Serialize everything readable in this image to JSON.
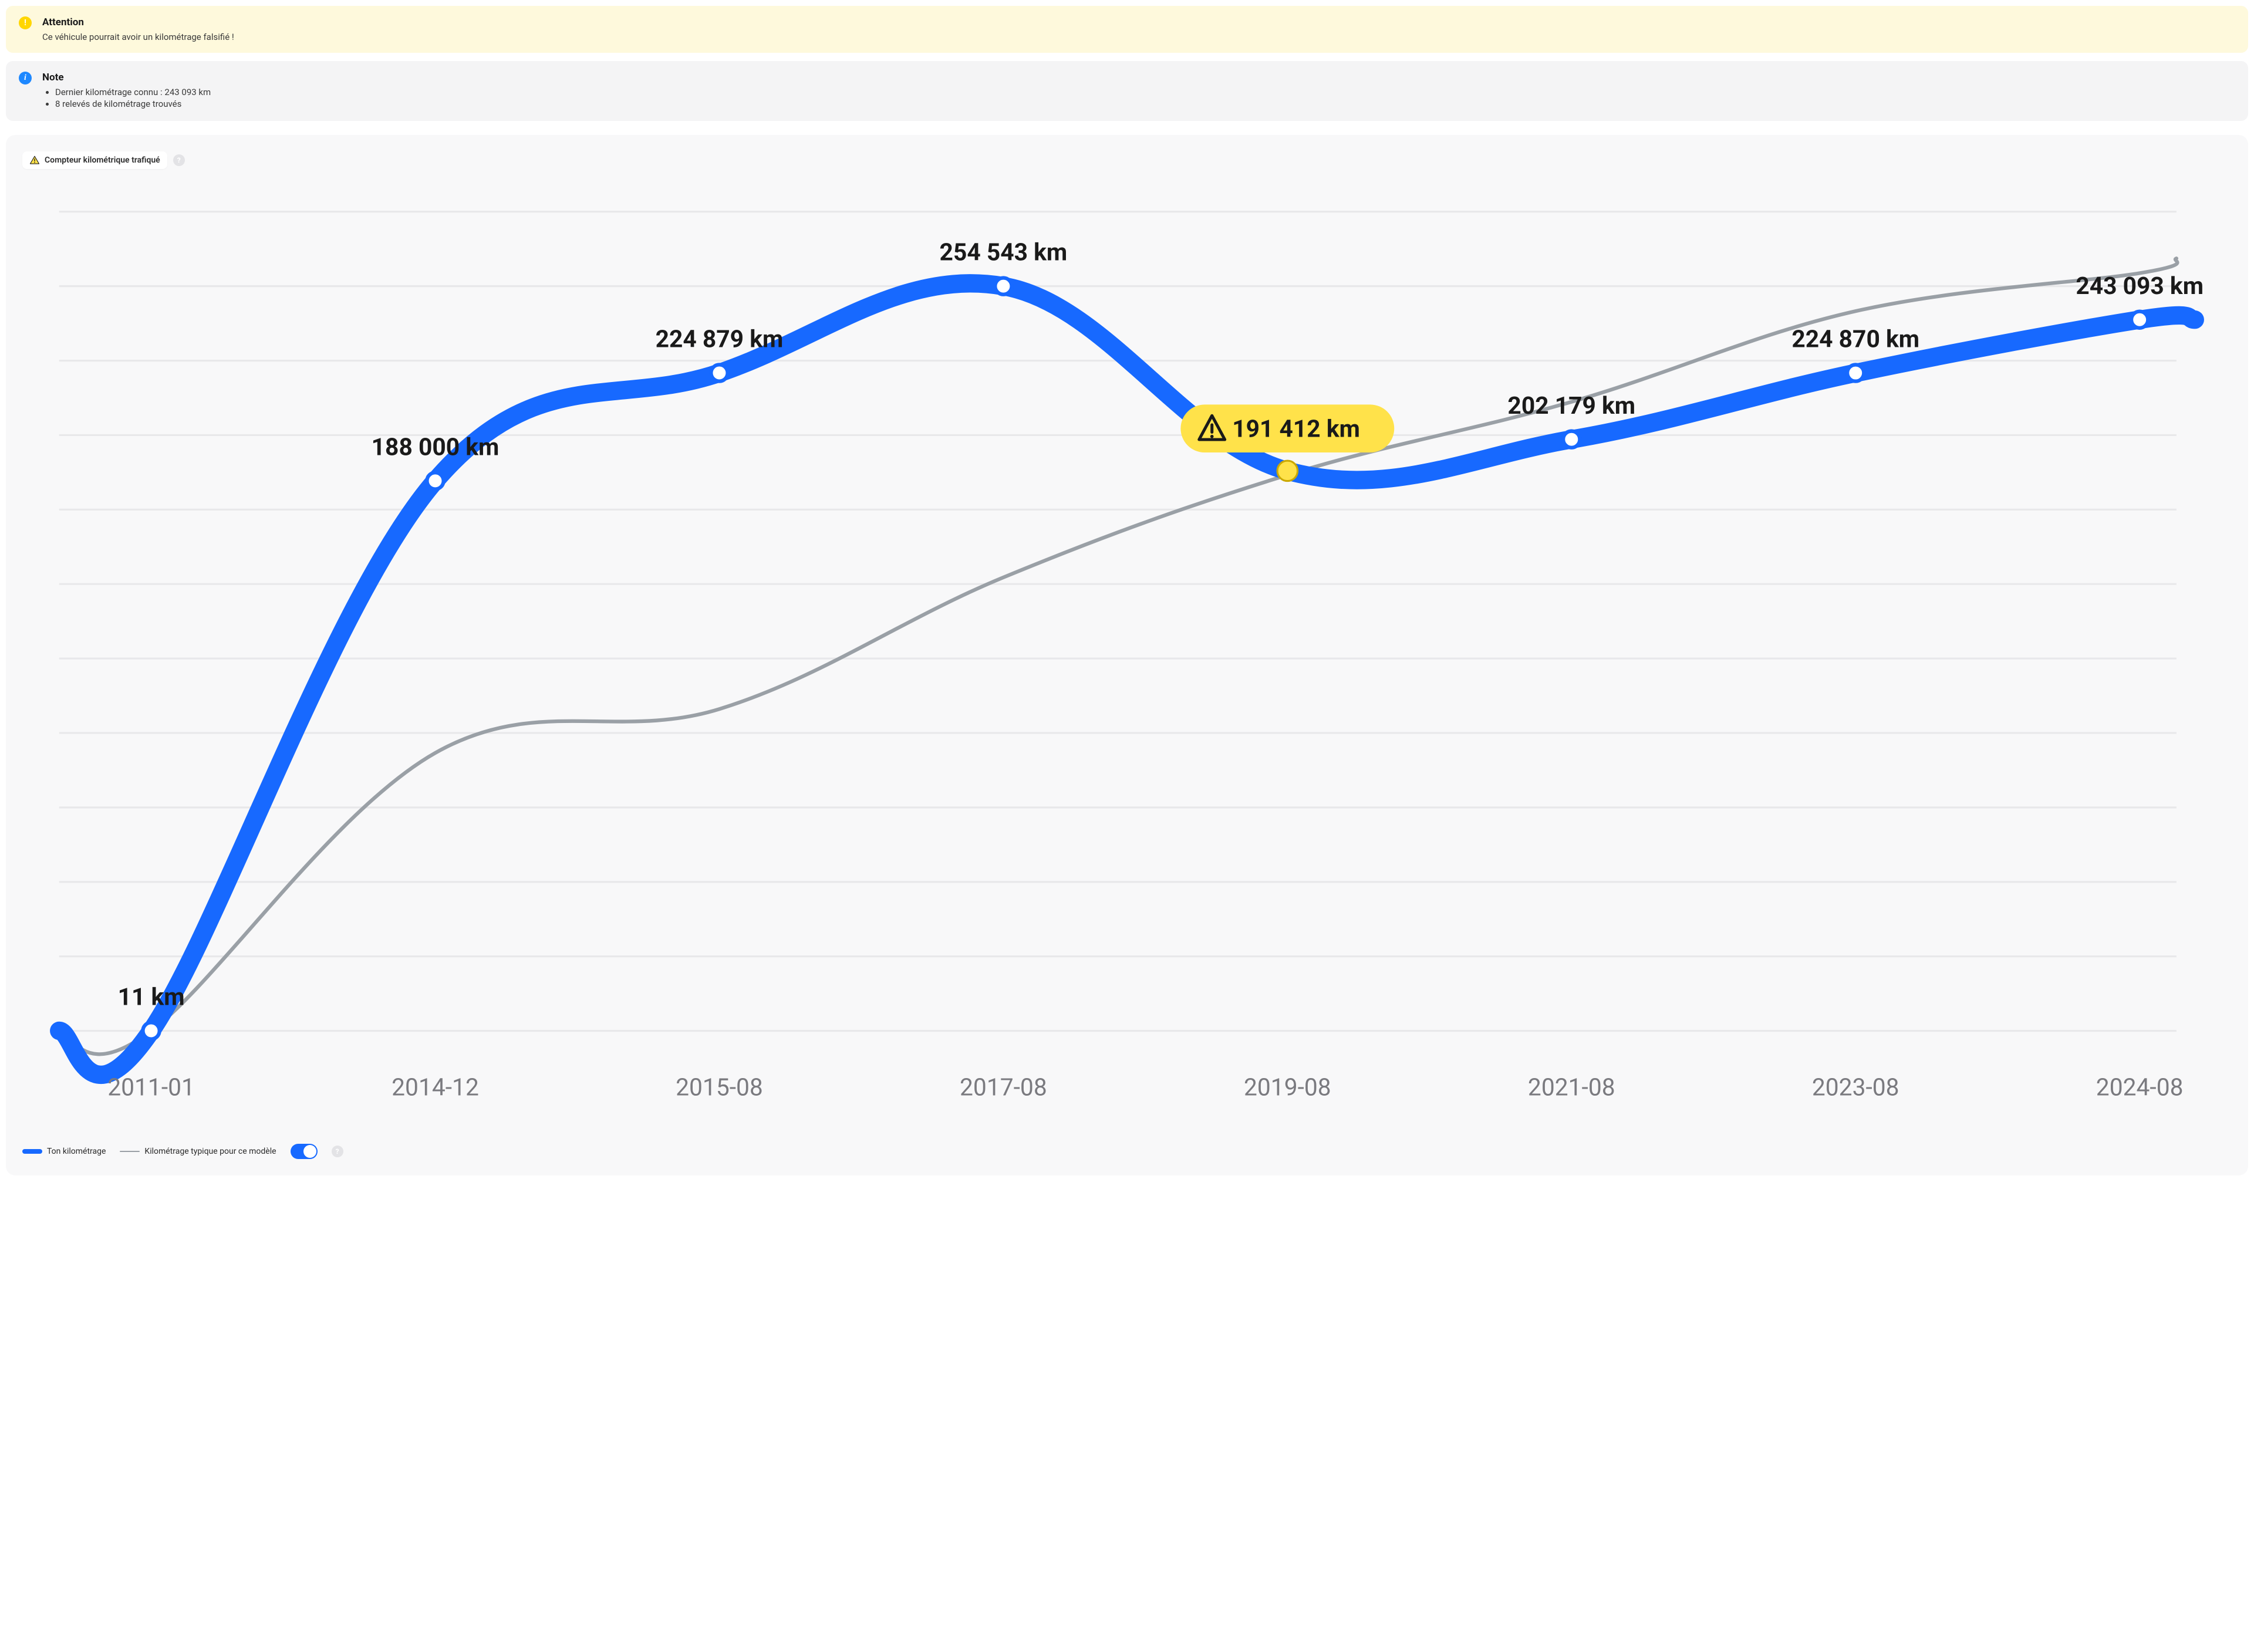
{
  "warning": {
    "title": "Attention",
    "text": "Ce véhicule pourrait avoir un kilométrage falsifié !"
  },
  "note": {
    "title": "Note",
    "items": [
      "Dernier kilométrage connu : 243 093 km",
      "8 relevés de kilométrage trouvés"
    ]
  },
  "tamper_badge": "Compteur kilométrique trafiqué",
  "legend": {
    "your": "Ton kilométrage",
    "typical": "Kilométrage typique pour ce modèle"
  },
  "chart_data": {
    "type": "line",
    "xlabel": "",
    "ylabel": "",
    "ylim": [
      0,
      280000
    ],
    "x_ticks": [
      "2011-01",
      "2014-12",
      "2015-08",
      "2017-08",
      "2019-08",
      "2021-08",
      "2023-08",
      "2024-08"
    ],
    "series": [
      {
        "name": "Ton kilométrage",
        "color": "#1769ff",
        "points": [
          {
            "x": "2011-01",
            "km": 11,
            "label": "11 km",
            "anomaly": false
          },
          {
            "x": "2014-12",
            "km": 188000,
            "label": "188 000 km",
            "anomaly": false
          },
          {
            "x": "2015-08",
            "km": 224879,
            "label": "224 879 km",
            "anomaly": false
          },
          {
            "x": "2017-08",
            "km": 254543,
            "label": "254 543 km",
            "anomaly": false
          },
          {
            "x": "2019-08",
            "km": 191412,
            "label": "191 412 km",
            "anomaly": true
          },
          {
            "x": "2021-08",
            "km": 202179,
            "label": "202 179 km",
            "anomaly": false
          },
          {
            "x": "2023-08",
            "km": 224870,
            "label": "224 870 km",
            "anomaly": false
          },
          {
            "x": "2024-08",
            "km": 243093,
            "label": "243 093 km",
            "anomaly": false
          }
        ]
      },
      {
        "name": "Kilométrage typique pour ce modèle",
        "color": "#9aa0a6",
        "points": [
          {
            "x": "2011-01",
            "km": 0
          },
          {
            "x": "2014-12",
            "km": 95000
          },
          {
            "x": "2015-08",
            "km": 110000
          },
          {
            "x": "2017-08",
            "km": 155000
          },
          {
            "x": "2019-08",
            "km": 190000
          },
          {
            "x": "2021-08",
            "km": 215000
          },
          {
            "x": "2023-08",
            "km": 246000
          },
          {
            "x": "2024-08",
            "km": 259000
          }
        ]
      }
    ]
  }
}
